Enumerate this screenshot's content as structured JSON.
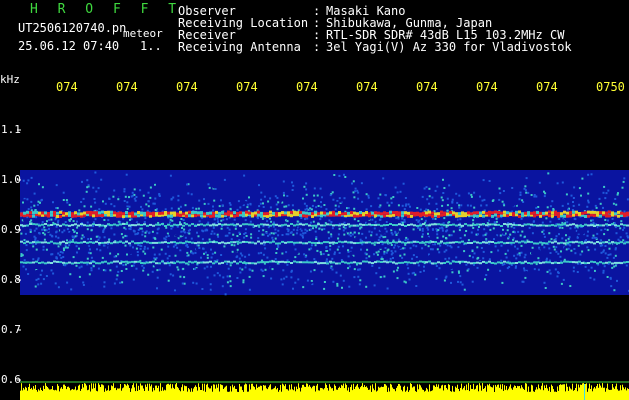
{
  "header": {
    "title": "H R O F F T",
    "filename": "UT2506120740.pn",
    "meteor_label": "meteor",
    "datetime": "25.06.12 07:40",
    "counter": "1..",
    "fields": [
      {
        "label": "Observer",
        "value": "Masaki Kano"
      },
      {
        "label": "Receiving Location",
        "value": "Shibukawa, Gunma, Japan"
      },
      {
        "label": "Receiver",
        "value": "RTL-SDR SDR# 43dB L15 103.2MHz CW"
      },
      {
        "label": "Receiving Antenna",
        "value": "3el Yagi(V) Az 330 for Vladivostok"
      }
    ]
  },
  "colors": {
    "background": "#000000",
    "header_title": "#3fd93f",
    "time_labels": "#ffff33",
    "signal_strength": "#ffff00",
    "noise_low": "#0a14a0",
    "noise_mid": "#1e5adc",
    "noise_high": "#3cc8c8",
    "peak": "#e01e28"
  },
  "chart_data": {
    "type": "heatmap",
    "title": "H R O F F T",
    "xlabel": "",
    "ylabel": "kHz",
    "x_tick_labels": [
      "074",
      "074",
      "074",
      "074",
      "074",
      "074",
      "074",
      "074",
      "074",
      "0750"
    ],
    "y_ticks": [
      0.6,
      0.7,
      0.8,
      0.9,
      1.0,
      1.1
    ],
    "y_tick_labels": [
      "0.6",
      "0.7",
      "0.8",
      "0.9",
      "1.0",
      "1.1"
    ],
    "ylim": [
      0.6,
      1.1
    ],
    "noise_band_khz": [
      0.77,
      1.02
    ],
    "bands_khz": [
      {
        "freq": 0.93,
        "strength": "high"
      },
      {
        "freq": 0.935,
        "strength": "high"
      },
      {
        "freq": 0.91,
        "strength": "medium"
      },
      {
        "freq": 0.875,
        "strength": "medium"
      },
      {
        "freq": 0.835,
        "strength": "medium"
      }
    ],
    "bottom_trace": "signal strength (yellow)",
    "grid": false,
    "legend": "none"
  }
}
